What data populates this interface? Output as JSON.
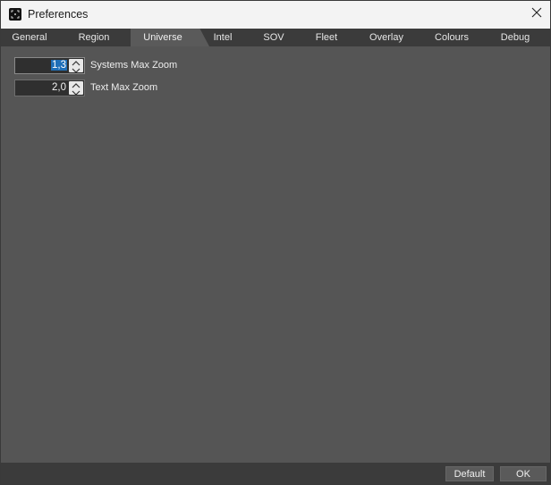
{
  "window": {
    "title": "Preferences",
    "close_label": "✕"
  },
  "tabs": [
    {
      "label": "General",
      "active": false
    },
    {
      "label": "Region",
      "active": false
    },
    {
      "label": "Universe",
      "active": true
    },
    {
      "label": "Intel",
      "active": false
    },
    {
      "label": "SOV",
      "active": false
    },
    {
      "label": "Fleet",
      "active": false
    },
    {
      "label": "Overlay",
      "active": false
    },
    {
      "label": "Colours",
      "active": false
    },
    {
      "label": "Debug",
      "active": false
    }
  ],
  "settings": {
    "systems_max_zoom": {
      "value": "1,3",
      "label": "Systems Max Zoom"
    },
    "text_max_zoom": {
      "value": "2,0",
      "label": "Text Max Zoom"
    }
  },
  "buttons": {
    "default_label": "Default",
    "ok_label": "OK"
  },
  "colors": {
    "background": "#555555",
    "tabbar": "#3b3b3b",
    "selection": "#1f6fb8"
  }
}
